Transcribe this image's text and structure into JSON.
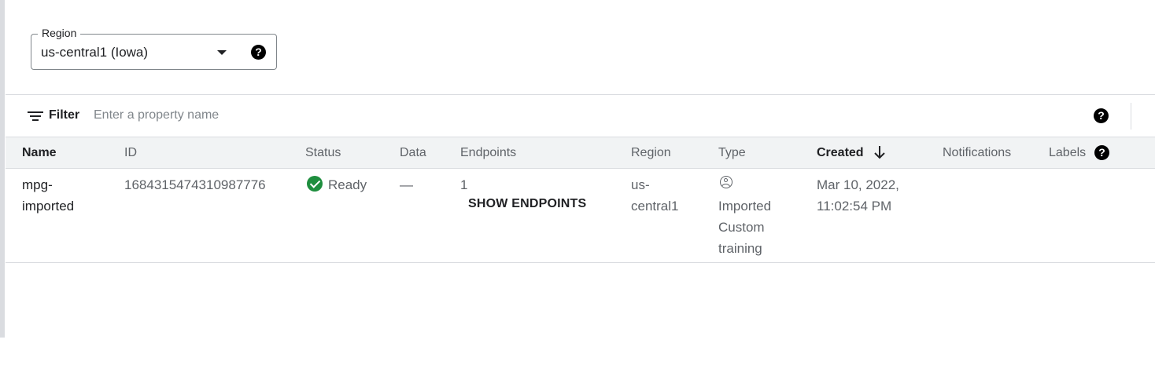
{
  "region": {
    "legend": "Region",
    "value": "us-central1 (Iowa)",
    "help_glyph": "?"
  },
  "filter": {
    "label": "Filter",
    "placeholder": "Enter a property name",
    "help_glyph": "?"
  },
  "table": {
    "columns": {
      "name": "Name",
      "id": "ID",
      "status": "Status",
      "data": "Data",
      "endpoints": "Endpoints",
      "region": "Region",
      "type": "Type",
      "created": "Created",
      "notifications": "Notifications",
      "labels": "Labels"
    },
    "labels_help_glyph": "?",
    "sort": {
      "column": "created",
      "direction": "descending"
    },
    "rows": [
      {
        "name_line1": "mpg-",
        "name_line2": "imported",
        "id": "1684315474310987776",
        "status": "Ready",
        "data": "—",
        "endpoints_count": "1",
        "endpoints_action": "SHOW ENDPOINTS",
        "region_line1": "us-",
        "region_line2": "central1",
        "type_line1": "Imported",
        "type_line2": "Custom",
        "type_line3": "training",
        "created_line1": "Mar 10, 2022,",
        "created_line2": "11:02:54 PM"
      }
    ]
  },
  "icons": {
    "status": "check-circle-icon",
    "type": "account-circle-icon",
    "filter": "filter-list-icon",
    "sort": "arrow-down-icon",
    "dropdown": "caret-down-icon"
  },
  "colors": {
    "status_ready": "#1e8e3e",
    "header_bg": "#f1f3f4",
    "divider": "#dadce0"
  }
}
